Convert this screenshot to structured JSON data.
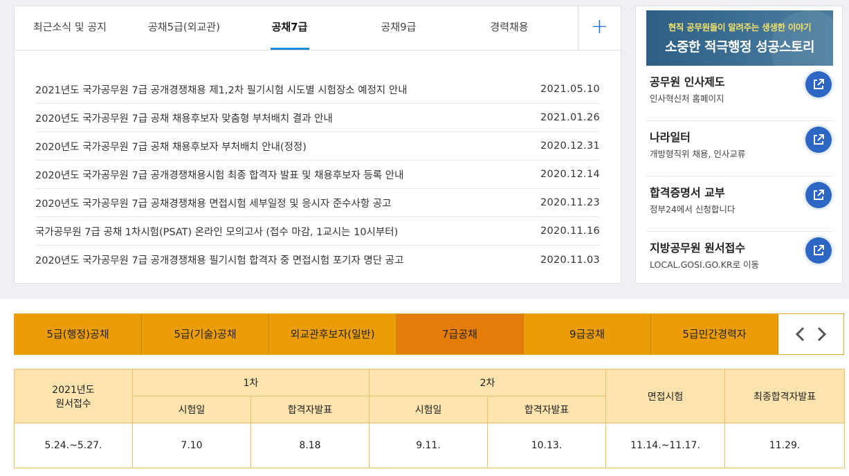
{
  "notice_tabs": [
    {
      "label": "최근소식 및 공지"
    },
    {
      "label": "공채5급(외교관)"
    },
    {
      "label": "공채7급"
    },
    {
      "label": "공채9급"
    },
    {
      "label": "경력채용"
    }
  ],
  "notice_more_label": "+",
  "notices": [
    {
      "title": "2021년도 국가공무원 7급 공개경쟁채용 제1,2차 필기시험 시도별 시험장소 예정지 안내",
      "date": "2021.05.10"
    },
    {
      "title": "2020년도 국가공무원 7급 공채 채용후보자 맞춤형 부처배치 결과 안내",
      "date": "2021.01.26"
    },
    {
      "title": "2020년도 국가공무원 7급 공채 채용후보자 부처배치 안내(정정)",
      "date": "2020.12.31"
    },
    {
      "title": "2020년도 국가공무원 7급 공개경쟁채용시험 최종 합격자 발표 및 채용후보자 등록 안내",
      "date": "2020.12.14"
    },
    {
      "title": "2020년도 국가공무원 7급 공채경쟁채용 면접시험 세부일정 및 응시자 준수사항 공고",
      "date": "2020.11.23"
    },
    {
      "title": "국가공무원 7급 공채 1차시험(PSAT) 온라인 모의고사 (접수 마감, 1교시는 10시부터)",
      "date": "2020.11.16"
    },
    {
      "title": "2020년도 국가공무원 7급 공개경쟁채용 필기시험 합격자 중 면접시험 포기자 명단 공고",
      "date": "2020.11.03"
    }
  ],
  "banner": {
    "subtitle": "현직 공무원들이 알려주는 생생한 이야기",
    "title": "소중한 적극행정 성공스토리"
  },
  "side_links": [
    {
      "title": "공무원 인사제도",
      "desc": "인사혁신처 홈페이지",
      "icon": "external-link-icon"
    },
    {
      "title": "나라일터",
      "desc": "개방형직위 채용, 인사교류",
      "icon": "external-link-icon"
    },
    {
      "title": "합격증명서 교부",
      "desc": "정부24에서 신청합니다",
      "icon": "external-link-icon"
    },
    {
      "title": "지방공무원 원서접수",
      "desc": "LOCAL.GOSI.GO.KR로 이동",
      "icon": "external-link-icon"
    }
  ],
  "exam_tabs": [
    {
      "label": "5급(행정)공채"
    },
    {
      "label": "5급(기술)공채"
    },
    {
      "label": "외교관후보자(일반)"
    },
    {
      "label": "7급공채"
    },
    {
      "label": "9급공채"
    },
    {
      "label": "5급민간경력자"
    }
  ],
  "schedule": {
    "col_application_line1": "2021년도",
    "col_application_line2": "원서접수",
    "col_round1": "1차",
    "col_round2": "2차",
    "col_interview": "면접시험",
    "col_final": "최종합격자발표",
    "sub_exam_date": "시험일",
    "sub_result": "합격자발표",
    "values": [
      "5.24.~5.27.",
      "7.10",
      "8.18",
      "9.11.",
      "10.13.",
      "11.14.~11.17.",
      "11.29."
    ]
  },
  "colors": {
    "accent_blue": "#1a8ad8",
    "link_button": "#2e66c3",
    "tab_orange": "#ea9c09",
    "tab_orange_active": "#e37c08",
    "table_header": "#fde3ae"
  }
}
